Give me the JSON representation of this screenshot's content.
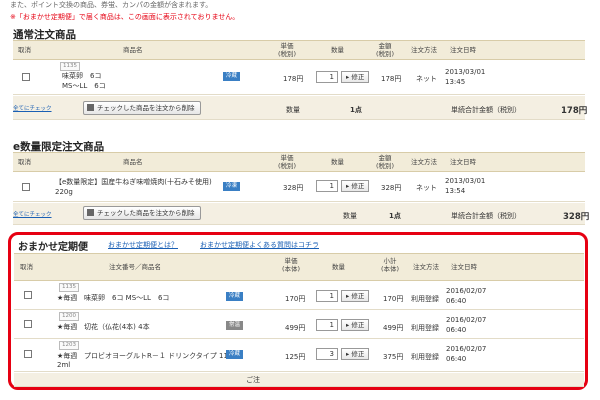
{
  "notes": {
    "top": "また、ポイント交換の商品、券蛍、カンパの金額が含まれます。",
    "red": "※「おまかせ定期便」で届く商品は、この画面に表示されておりません。"
  },
  "regular": {
    "title": "通常注文商品",
    "headers": {
      "cancel": "取消",
      "product": "商品名",
      "unit_price": "単価\n(税別)",
      "quantity": "数量",
      "amount": "金額\n(税別)",
      "payment": "注文方法",
      "date": "注文日時"
    },
    "rows": [
      {
        "code": "1135",
        "name_line1": "味菜卵　6コ",
        "name_line2": "MS～LL　6コ",
        "badge": "冷蔵",
        "price": "178円",
        "qty": "1",
        "fix": "▸ 修正",
        "amount": "178円",
        "method": "ネット",
        "date1": "2013/03/01",
        "date2": "13:45"
      }
    ],
    "check_all": "全てにチェック",
    "delete_btn": "チェックした商品を注文から削除",
    "qty_label": "数量",
    "qty_total": "1点",
    "sum_label": "単続合計金額（税別）",
    "sum_value": "178円"
  },
  "limited": {
    "title": "e数量限定注文商品",
    "headers": {
      "cancel": "取消",
      "product": "商品名",
      "unit_price": "単価\n(税別)",
      "quantity": "数量",
      "amount": "金額\n(税別)",
      "payment": "注文方法",
      "date": "注文日時"
    },
    "rows": [
      {
        "name_line1": "【e数量限定】国産牛ねぎ味噌焼肉(十石みそ使用)",
        "name_line2": "220g",
        "badge": "冷凍",
        "price": "328円",
        "qty": "1",
        "fix": "▸ 修正",
        "amount": "328円",
        "method": "ネット",
        "date1": "2013/03/01",
        "date2": "13:54"
      }
    ],
    "check_all": "全てにチェック",
    "delete_btn": "チェックした商品を注文から削除",
    "qty_label": "数量",
    "qty_total": "1点",
    "sum_label": "単続合計金額（税別）",
    "sum_value": "328円"
  },
  "omakase": {
    "title": "おまかせ定期便",
    "link1": "おまかせ定期便とは？",
    "link2": "おまかせ定期便よくある質問はコチラ",
    "headers": {
      "cancel": "取消",
      "product": "注文番号／商品名",
      "unit_price": "単価\n(本体)",
      "quantity": "数量",
      "subtotal": "小計\n(本体)",
      "payment": "注文方法",
      "date": "注文日時"
    },
    "rows": [
      {
        "code": "1135",
        "tag": "★毎週",
        "name_line1": "味菜卵　6コ MS～LL　6コ",
        "name_line2": "",
        "badge": "冷蔵",
        "badge_type": "chill",
        "price": "170円",
        "qty": "1",
        "fix": "▸ 修正",
        "subtotal": "170円",
        "method": "利用登録",
        "date1": "2016/02/07",
        "date2": "06:40"
      },
      {
        "code": "1200",
        "tag": "★毎週",
        "name_line1": "切花（仏花(4本) 4本",
        "name_line2": "",
        "badge": "常温",
        "badge_type": "normal",
        "price": "499円",
        "qty": "1",
        "fix": "▸ 修正",
        "subtotal": "499円",
        "method": "利用登録",
        "date1": "2016/02/07",
        "date2": "06:40"
      },
      {
        "code": "1203",
        "tag": "★毎週",
        "name_line1": "プロビオヨーグルトR－１ ドリンクタイプ 11",
        "name_line2": "2ml",
        "badge": "冷蔵",
        "badge_type": "chill",
        "price": "125円",
        "qty": "3",
        "fix": "▸ 修正",
        "subtotal": "375円",
        "method": "利用登録",
        "date1": "2016/02/07",
        "date2": "06:40"
      }
    ],
    "footer_note": "ご注"
  }
}
